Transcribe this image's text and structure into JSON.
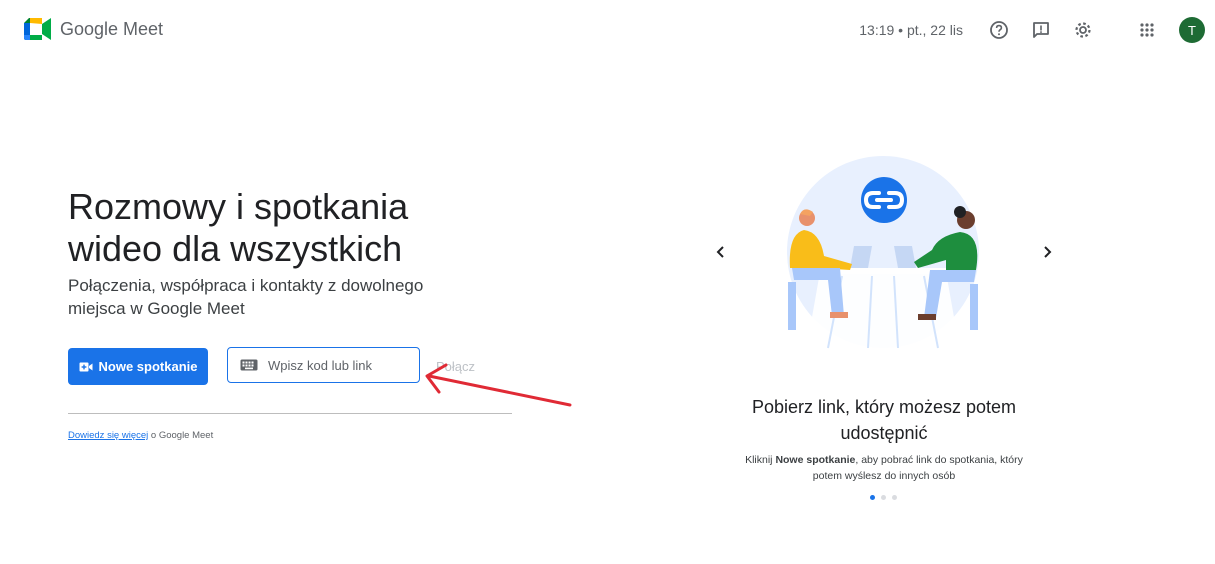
{
  "header": {
    "app_name": "Google Meet",
    "datetime": "13:19 • pt., 22 lis",
    "icons": [
      "help-icon",
      "feedback-icon",
      "settings-icon",
      "apps-grid-icon"
    ],
    "avatar_letter": "T",
    "avatar_color": "#1e6b34"
  },
  "hero": {
    "title": "Rozmowy i spotkania wideo dla wszystkich",
    "subtitle": "Połączenia, współpraca i kontakty z dowolnego miejsca w Google Meet"
  },
  "actions": {
    "new_meeting_label": "Nowe spotkanie",
    "code_placeholder": "Wpisz kod lub link",
    "code_value": "",
    "join_label": "Połącz"
  },
  "learn_more": {
    "link_text": "Dowiedz się więcej",
    "suffix": " o Google Meet"
  },
  "carousel": {
    "slide_title": "Pobierz link, który możesz potem udostępnić",
    "desc_prefix": "Kliknij ",
    "desc_bold": "Nowe spotkanie",
    "desc_suffix": ", aby pobrać link do spotkania, który potem wyślesz do innych osób",
    "active_dot": 0,
    "dot_count": 3
  },
  "colors": {
    "accent": "#1a73e8",
    "annotation_arrow": "#e02a35"
  }
}
